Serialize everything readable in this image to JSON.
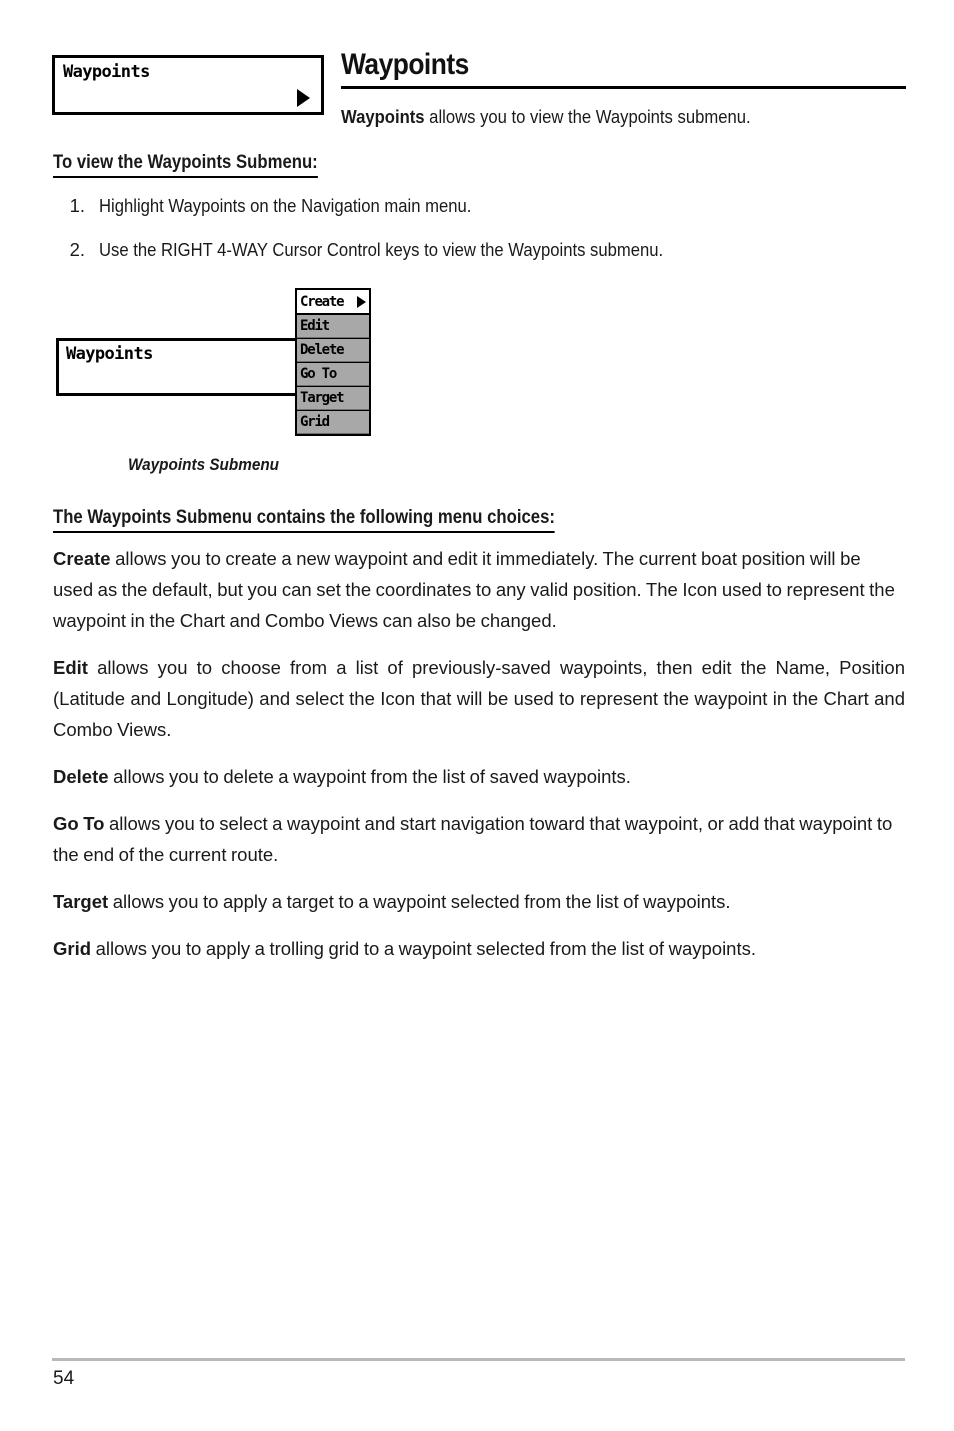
{
  "header": {
    "title": "Waypoints",
    "intro_bold": "Waypoints",
    "intro_rest": " allows you to view the Waypoints submenu."
  },
  "lcd_top_menu": {
    "label": "Waypoints",
    "arrow_icon": "triangle-right-icon"
  },
  "section_view": {
    "heading": "To view the Waypoints Submenu:",
    "steps": [
      {
        "num": "1.",
        "text": "Highlight Waypoints on the Navigation main menu."
      },
      {
        "num": "2.",
        "text": "Use the RIGHT 4-WAY Cursor Control keys to view the Waypoints submenu."
      }
    ]
  },
  "diagram": {
    "parent_label": "Waypoints",
    "caption": "Waypoints Submenu",
    "submenu_items": [
      {
        "label": "Create",
        "selected": true,
        "arrow": "triangle-right-icon"
      },
      {
        "label": "Edit",
        "selected": false,
        "arrow": ""
      },
      {
        "label": "Delete",
        "selected": false,
        "arrow": ""
      },
      {
        "label": "Go To",
        "selected": false,
        "arrow": ""
      },
      {
        "label": "Target",
        "selected": false,
        "arrow": ""
      },
      {
        "label": "Grid",
        "selected": false,
        "arrow": ""
      }
    ]
  },
  "section_choices": {
    "heading": "The Waypoints Submenu contains the following menu choices:",
    "entries": [
      {
        "term": "Create",
        "text": " allows you to create a new waypoint and edit it immediately.  The current boat position will be used as the default, but you can set the coordinates to any valid position. The Icon used to represent the waypoint in the Chart and Combo Views can also be changed.",
        "justify": false
      },
      {
        "term": "Edit",
        "text": " allows you to choose from a list of previously-saved waypoints, then edit the Name, Position (Latitude and Longitude) and select the Icon that will be used to represent the waypoint in the Chart and Combo Views.",
        "justify": true
      },
      {
        "term": "Delete",
        "text": " allows you to delete a waypoint from the list of saved waypoints.",
        "justify": false
      },
      {
        "term": "Go To",
        "text": " allows you to select a waypoint and start navigation toward that waypoint, or add that waypoint to the end of the current route.",
        "justify": false
      },
      {
        "term": "Target",
        "text": " allows you to apply a target to a waypoint selected from the list of waypoints.",
        "justify": false
      },
      {
        "term": "Grid",
        "text": " allows you to apply a trolling grid to a waypoint selected from the list of waypoints.",
        "justify": false
      }
    ]
  },
  "footer": {
    "page_number": "54"
  },
  "colors": {
    "ink": "#1a1a1a",
    "rule": "#000000",
    "footer_rule": "#b9b9b9",
    "menu_gray": "#a8a8a8",
    "menu_selected": "#ffffff"
  }
}
